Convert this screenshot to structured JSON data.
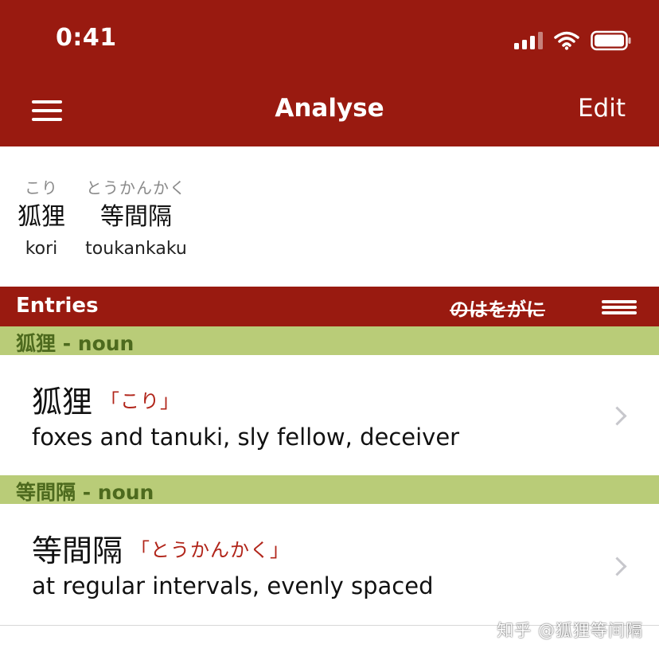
{
  "status": {
    "time": "0:41"
  },
  "nav": {
    "title": "Analyse",
    "edit_label": "Edit"
  },
  "analysis": {
    "words": [
      {
        "furigana": "こり",
        "kanji": "狐狸",
        "romaji": "kori"
      },
      {
        "furigana": "とうかんかく",
        "kanji": "等間隔",
        "romaji": "toukankaku"
      }
    ]
  },
  "entries": {
    "title": "Entries",
    "particles": "のはをがに",
    "sections": [
      {
        "header": "狐狸 - noun",
        "kanji": "狐狸",
        "reading": "「こり」",
        "gloss": "foxes and tanuki, sly fellow, deceiver"
      },
      {
        "header": "等間隔 - noun",
        "kanji": "等間隔",
        "reading": "「とうかんかく」",
        "gloss": "at regular intervals, evenly spaced"
      }
    ]
  },
  "watermark": "知乎 @狐狸等间隔",
  "colors": {
    "brand_red": "#991a10",
    "section_green": "#b9cc78",
    "section_text": "#4d6a1e",
    "reading_red": "#b1251a"
  },
  "icons": [
    "signal-icon",
    "wifi-icon",
    "battery-icon",
    "hamburger-menu-icon",
    "chevron-right-icon"
  ]
}
